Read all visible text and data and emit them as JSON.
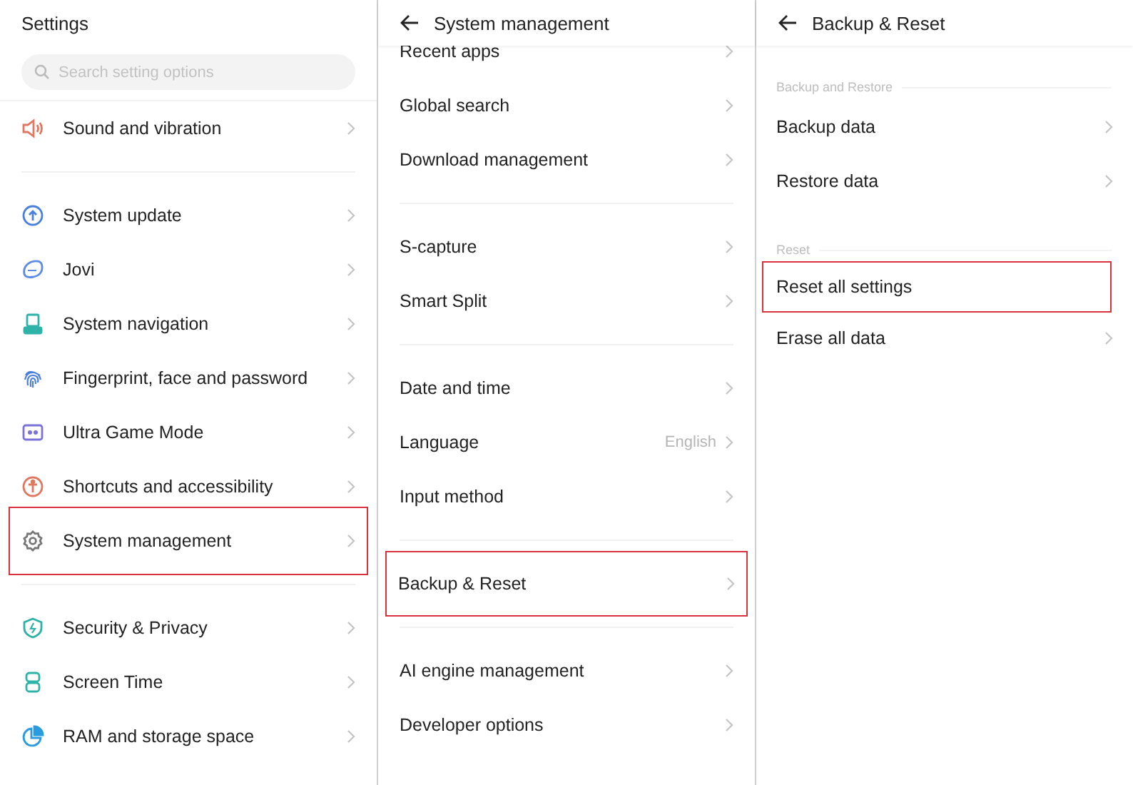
{
  "panels": [
    {
      "title": "Settings",
      "back": false,
      "search": {
        "placeholder": "Search setting options"
      },
      "groups": [
        {
          "items": [
            {
              "label": "Sound and vibration",
              "chevron": true,
              "highlighted": false
            }
          ]
        },
        {
          "items": [
            {
              "label": "System update",
              "chevron": true,
              "highlighted": false
            },
            {
              "label": "Jovi",
              "chevron": true,
              "highlighted": false
            },
            {
              "label": "System navigation",
              "chevron": true,
              "highlighted": false
            },
            {
              "label": "Fingerprint, face and password",
              "chevron": true,
              "highlighted": false
            },
            {
              "label": "Ultra Game Mode",
              "chevron": true,
              "highlighted": false
            },
            {
              "label": "Shortcuts and accessibility",
              "chevron": true,
              "highlighted": false
            },
            {
              "label": "System management",
              "chevron": true,
              "highlighted": true
            }
          ]
        },
        {
          "items": [
            {
              "label": "Security & Privacy",
              "chevron": true,
              "highlighted": false
            },
            {
              "label": "Screen Time",
              "chevron": true,
              "highlighted": false
            },
            {
              "label": "RAM and storage space",
              "chevron": true,
              "highlighted": false
            }
          ]
        }
      ]
    },
    {
      "title": "System management",
      "back": true,
      "groups": [
        {
          "items": [
            {
              "label": "Recent apps",
              "chevron": true,
              "highlighted": false
            },
            {
              "label": "Global search",
              "chevron": true,
              "highlighted": false
            },
            {
              "label": "Download management",
              "chevron": true,
              "highlighted": false
            }
          ]
        },
        {
          "items": [
            {
              "label": "S-capture",
              "chevron": true,
              "highlighted": false
            },
            {
              "label": "Smart Split",
              "chevron": true,
              "highlighted": false
            }
          ]
        },
        {
          "items": [
            {
              "label": "Date and time",
              "chevron": true,
              "highlighted": false
            },
            {
              "label": "Language",
              "value": "English",
              "chevron": true,
              "highlighted": false
            },
            {
              "label": "Input method",
              "chevron": true,
              "highlighted": false
            }
          ]
        },
        {
          "items": [
            {
              "label": "Backup & Reset",
              "chevron": true,
              "highlighted": true
            }
          ]
        },
        {
          "items": [
            {
              "label": "AI engine management",
              "chevron": true,
              "highlighted": false
            },
            {
              "label": "Developer options",
              "chevron": true,
              "highlighted": false
            }
          ]
        }
      ]
    },
    {
      "title": "Backup & Reset",
      "back": true,
      "groups": [
        {
          "heading": "Backup and Restore",
          "items": [
            {
              "label": "Backup data",
              "chevron": true,
              "highlighted": false
            },
            {
              "label": "Restore data",
              "chevron": true,
              "highlighted": false
            }
          ]
        },
        {
          "heading": "Reset",
          "items": [
            {
              "label": "Reset all settings",
              "chevron": false,
              "highlighted": true
            },
            {
              "label": "Erase all data",
              "chevron": true,
              "highlighted": false
            }
          ]
        }
      ]
    }
  ]
}
